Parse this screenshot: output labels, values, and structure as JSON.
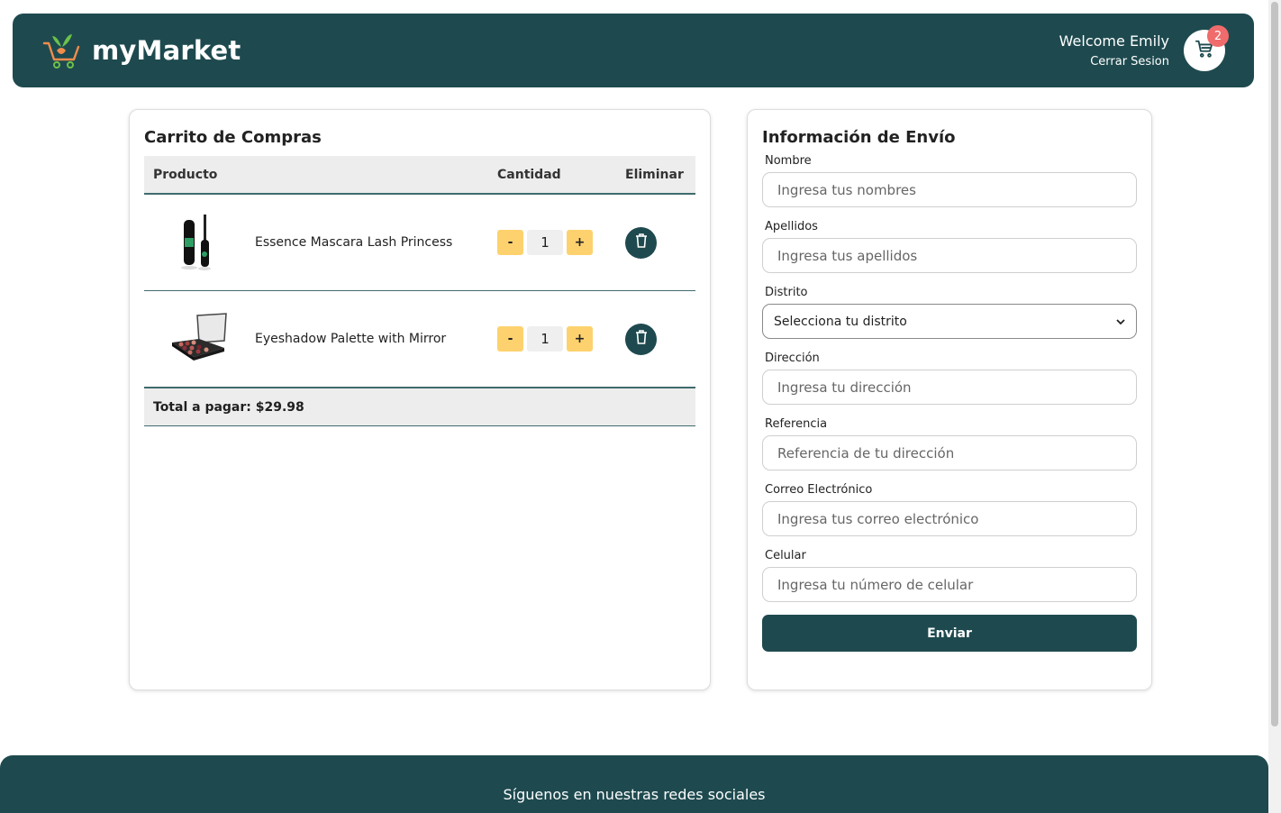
{
  "header": {
    "brand": "myMarket",
    "welcome": "Welcome Emily",
    "logout": "Cerrar Sesion",
    "cart_count": "2"
  },
  "cart": {
    "title": "Carrito de Compras",
    "columns": {
      "product": "Producto",
      "quantity": "Cantidad",
      "remove": "Eliminar"
    },
    "items": [
      {
        "name": "Essence Mascara Lash Princess",
        "qty": "1",
        "minus": "-",
        "plus": "+"
      },
      {
        "name": "Eyeshadow Palette with Mirror",
        "qty": "1",
        "minus": "-",
        "plus": "+"
      }
    ],
    "total": "Total a pagar: $29.98"
  },
  "shipping": {
    "title": "Información de Envío",
    "fields": {
      "nombre": {
        "label": "Nombre",
        "placeholder": "Ingresa tus nombres"
      },
      "apellidos": {
        "label": "Apellidos",
        "placeholder": "Ingresa tus apellidos"
      },
      "distrito": {
        "label": "Distrito",
        "selected": "Selecciona tu distrito"
      },
      "direccion": {
        "label": "Dirección",
        "placeholder": "Ingresa tu dirección"
      },
      "referencia": {
        "label": "Referencia",
        "placeholder": "Referencia de tu dirección"
      },
      "correo": {
        "label": "Correo Electrónico",
        "placeholder": "Ingresa tus correo electrónico"
      },
      "celular": {
        "label": "Celular",
        "placeholder": "Ingresa tu número de celular"
      }
    },
    "submit": "Enviar"
  },
  "footer": {
    "text": "Síguenos en nuestras redes sociales"
  },
  "colors": {
    "primary": "#1e4a4f",
    "accent": "#fdd26e",
    "badge": "#f06b6b"
  }
}
